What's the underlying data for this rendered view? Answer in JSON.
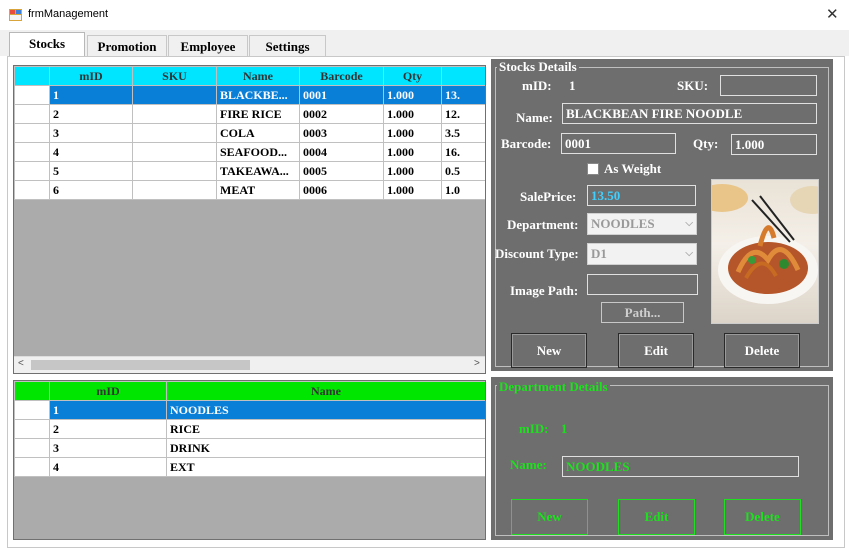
{
  "window": {
    "title": "frmManagement",
    "close_glyph": "✕"
  },
  "tabs": [
    {
      "label": "Stocks",
      "active": true
    },
    {
      "label": "Promotion",
      "active": false
    },
    {
      "label": "Employee",
      "active": false
    },
    {
      "label": "Settings",
      "active": false
    }
  ],
  "stocks_grid": {
    "columns": [
      "mID",
      "SKU",
      "Name",
      "Barcode",
      "Qty",
      ""
    ],
    "rows": [
      {
        "mID": "1",
        "SKU": "",
        "Name": "BLACKBE...",
        "Barcode": "0001",
        "Qty": "1.000",
        "Price": "13.",
        "selected": true
      },
      {
        "mID": "2",
        "SKU": "",
        "Name": "FIRE RICE",
        "Barcode": "0002",
        "Qty": "1.000",
        "Price": "12.",
        "selected": false
      },
      {
        "mID": "3",
        "SKU": "",
        "Name": "COLA",
        "Barcode": "0003",
        "Qty": "1.000",
        "Price": "3.5",
        "selected": false
      },
      {
        "mID": "4",
        "SKU": "",
        "Name": "SEAFOOD...",
        "Barcode": "0004",
        "Qty": "1.000",
        "Price": "16.",
        "selected": false
      },
      {
        "mID": "5",
        "SKU": "",
        "Name": "TAKEAWA...",
        "Barcode": "0005",
        "Qty": "1.000",
        "Price": "0.5",
        "selected": false
      },
      {
        "mID": "6",
        "SKU": "",
        "Name": "MEAT",
        "Barcode": "0006",
        "Qty": "1.000",
        "Price": "1.0",
        "selected": false
      }
    ]
  },
  "dept_grid": {
    "columns": [
      "mID",
      "Name"
    ],
    "rows": [
      {
        "mID": "1",
        "Name": "NOODLES",
        "selected": true
      },
      {
        "mID": "2",
        "Name": "RICE",
        "selected": false
      },
      {
        "mID": "3",
        "Name": "DRINK",
        "selected": false
      },
      {
        "mID": "4",
        "Name": "EXT",
        "selected": false
      }
    ]
  },
  "stock_details": {
    "group_title": "Stocks Details",
    "mid_label": "mID:",
    "mid_value": "1",
    "sku_label": "SKU:",
    "sku_value": "",
    "name_label": "Name:",
    "name_value": "BLACKBEAN FIRE NOODLE",
    "barcode_label": "Barcode:",
    "barcode_value": "0001",
    "qty_label": "Qty:",
    "qty_value": "1.000",
    "as_weight_label": "As Weight",
    "saleprice_label": "SalePrice:",
    "saleprice_value": "13.50",
    "department_label": "Department:",
    "department_value": "NOODLES",
    "discount_label": "Discount Type:",
    "discount_value": "D1",
    "imagepath_label": "Image Path:",
    "imagepath_value": "",
    "path_button": "Path...",
    "new_button": "New",
    "edit_button": "Edit",
    "delete_button": "Delete"
  },
  "dept_details": {
    "group_title": "Department Details",
    "mid_label": "mID:",
    "mid_value": "1",
    "name_label": "Name:",
    "name_value": "NOODLES",
    "new_button": "New",
    "edit_button": "Edit",
    "delete_button": "Delete"
  },
  "colors": {
    "stock_header": "#00e5ff",
    "dept_header": "#00e600",
    "selection": "#0a7fd8",
    "details_bg": "#6e6e6e",
    "dept_accent": "#1ee01e"
  }
}
